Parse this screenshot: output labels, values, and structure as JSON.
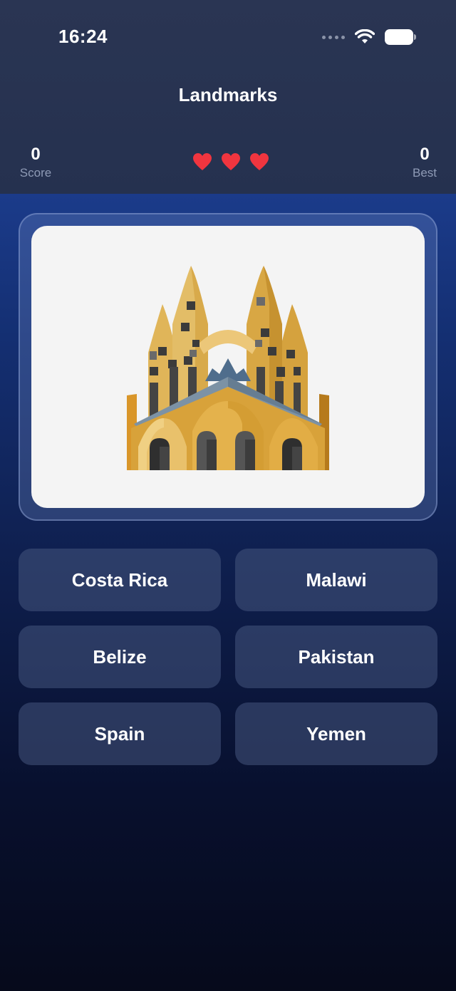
{
  "status_bar": {
    "time": "16:24",
    "icons": [
      "cellular-signal-icon",
      "wifi-icon",
      "battery-icon"
    ]
  },
  "header": {
    "title": "Landmarks",
    "score": {
      "value": "0",
      "label": "Score"
    },
    "best": {
      "value": "0",
      "label": "Best"
    },
    "lives": {
      "remaining": 3,
      "max": 3,
      "icon": "heart-icon",
      "color": "#f0353f"
    }
  },
  "question": {
    "image": "sagrada-familia-icon"
  },
  "answers": [
    {
      "label": "Costa Rica"
    },
    {
      "label": "Malawi"
    },
    {
      "label": "Belize"
    },
    {
      "label": "Pakistan"
    },
    {
      "label": "Spain"
    },
    {
      "label": "Yemen"
    }
  ],
  "colors": {
    "header_bg": "#27324f",
    "main_bg_top": "#1b3b8a",
    "main_bg_bottom": "#060a1b",
    "card_bg": "#f4f4f4",
    "answer_bg": "#3a4668",
    "heart": "#f0353f"
  }
}
